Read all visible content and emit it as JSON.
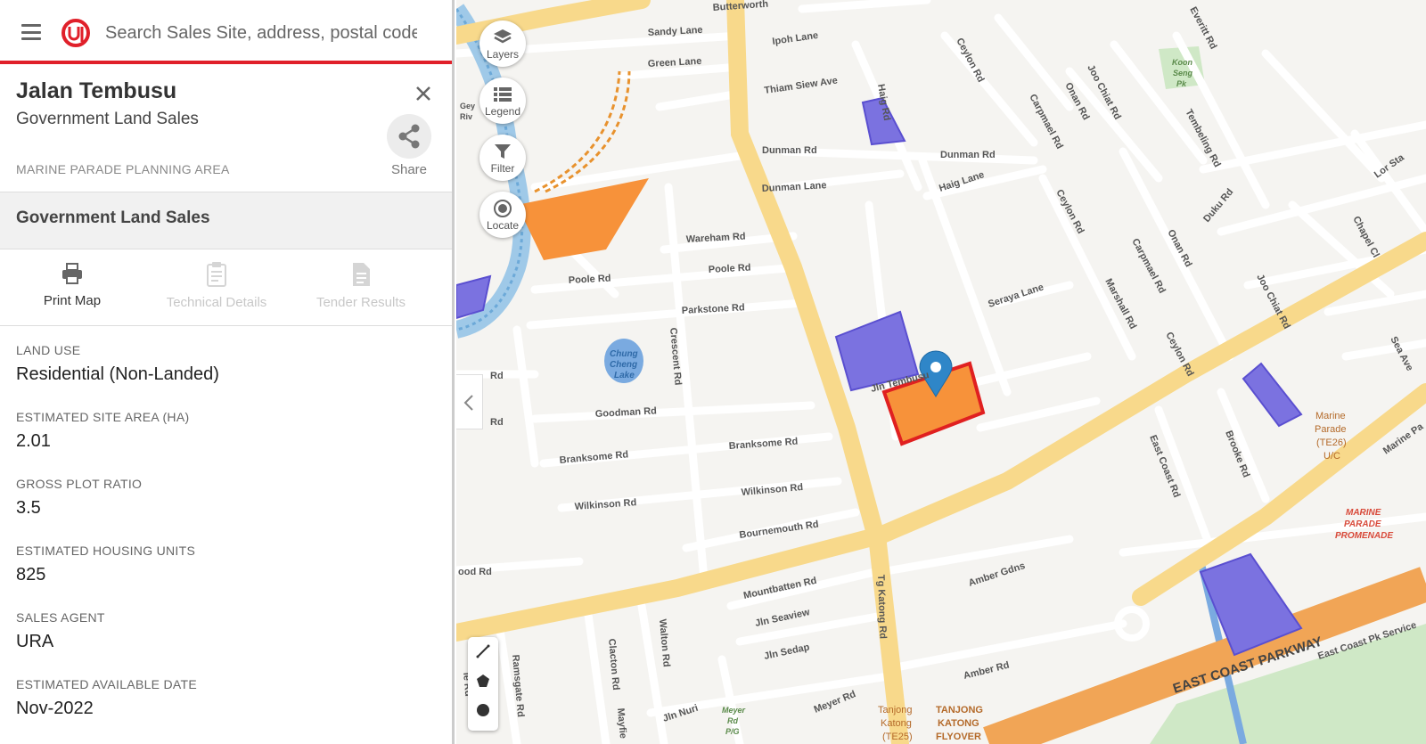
{
  "search": {
    "placeholder": "Search Sales Site, address, postal code"
  },
  "site": {
    "title": "Jalan Tembusu",
    "subtitle": "Government Land Sales",
    "planning_area": "MARINE PARADE PLANNING AREA",
    "share_label": "Share"
  },
  "section": {
    "title": "Government Land Sales"
  },
  "actions": [
    {
      "label": "Print Map",
      "icon": "printer-icon",
      "enabled": true
    },
    {
      "label": "Technical Details",
      "icon": "clipboard-icon",
      "enabled": false
    },
    {
      "label": "Tender Results",
      "icon": "document-icon",
      "enabled": false
    }
  ],
  "details": [
    {
      "label": "LAND USE",
      "value": "Residential (Non-Landed)"
    },
    {
      "label": "ESTIMATED SITE AREA (HA)",
      "value": "2.01"
    },
    {
      "label": "GROSS PLOT RATIO",
      "value": "3.5"
    },
    {
      "label": "ESTIMATED HOUSING UNITS",
      "value": "825"
    },
    {
      "label": "SALES AGENT",
      "value": "URA"
    },
    {
      "label": "ESTIMATED AVAILABLE DATE",
      "value": "Nov-2022"
    }
  ],
  "map_controls": [
    {
      "label": "Layers",
      "icon": "layers-icon"
    },
    {
      "label": "Legend",
      "icon": "legend-icon"
    },
    {
      "label": "Filter",
      "icon": "filter-icon"
    },
    {
      "label": "Locate",
      "icon": "locate-icon"
    }
  ],
  "draw_tools": [
    "line-tool-icon",
    "polygon-tool-icon",
    "circle-tool-icon"
  ],
  "colors": {
    "accent": "#e0202a",
    "site_fill": "#f7923a",
    "site_outline": "#e02020",
    "glsites": "#7b72e0",
    "major_road": "#f8d98b",
    "expressway": "#f1a556",
    "canal": "#7aaae0",
    "park": "#cfe8c6",
    "marker": "#2f86c8"
  },
  "map_labels": {
    "butterworth": "Butterworth",
    "sandy_lane": "Sandy Lane",
    "ipoh_lane": "Ipoh Lane",
    "green_lane": "Green Lane",
    "thiam_siew": "Thiam Siew Ave",
    "haig_rd": "Haig Rd",
    "ceylon_rd": "Ceylon Rd",
    "joo_chiat": "Joo Chiat Rd",
    "everitt": "Everitt Rd",
    "koon_seng_a": "Koon",
    "koon_seng_b": "Seng",
    "koon_seng_c": "Pk",
    "carpmael": "Carpmael Rd",
    "onan": "Onan Rd",
    "tembeling": "Tembeling Rd",
    "lor_stangee": "Lor Sta",
    "dunman_rd": "Dunman Rd",
    "dunman_lane": "Dunman Lane",
    "haig_lane": "Haig Lane",
    "duku": "Duku Rd",
    "chapel": "Chapel Cl",
    "wareham": "Wareham Rd",
    "poole": "Poole Rd",
    "parkstone": "Parkstone Rd",
    "seraya": "Seraya Lane",
    "marshall": "Marshall Rd",
    "crescent": "Crescent Rd",
    "chung_a": "Chung",
    "chung_b": "Cheng",
    "chung_c": "Lake",
    "jln_tembusu": "Jln Tembusu",
    "goodman": "Goodman Rd",
    "branksome": "Branksome Rd",
    "wilkinson": "Wilkinson Rd",
    "bournemouth": "Bournemouth Rd",
    "east_coast_rd": "East Coast Rd",
    "brooke": "Brooke Rd",
    "sea_ave": "Sea Ave",
    "marine_parade_a": "Marine",
    "marine_parade_b": "Parade",
    "marine_parade_c": "(TE26)",
    "marine_parade_d": "U/C",
    "marine_parade_rd": "Marine Pa",
    "promenade_a": "MARINE",
    "promenade_b": "PARADE",
    "promenade_c": "PROMENADE",
    "mountbatten": "Mountbatten Rd",
    "amber_gdns": "Amber Gdns",
    "jln_seaview": "Jln Seaview",
    "jln_sedap": "Jln Sedap",
    "tg_katong": "Tg Katong Rd",
    "amber_rd": "Amber Rd",
    "ecp": "EAST COAST PARKWAY",
    "ecp_service": "East Coast Pk Service",
    "rd_a": "Rd",
    "rd_b": "Rd",
    "rd_c": "ood Rd",
    "ramsgate": "Ramsgate Rd",
    "clacton": "Clacton Rd",
    "walton": "Walton Rd",
    "jln_nuri": "Jln Nuri",
    "meyer_pg_a": "Meyer",
    "meyer_pg_b": "Rd",
    "meyer_pg_c": "P/G",
    "meyer_rd": "Meyer Rd",
    "tj_katong_a": "Tanjong",
    "tj_katong_b": "Katong",
    "tj_katong_c": "(TE25)",
    "tj_flyover_a": "TANJONG",
    "tj_flyover_b": "KATONG",
    "tj_flyover_c": "FLYOVER",
    "mayfield": "Mayfie",
    "geylang_a": "Gey",
    "geylang_b": "Riv",
    "side_a": "ie Rd"
  }
}
